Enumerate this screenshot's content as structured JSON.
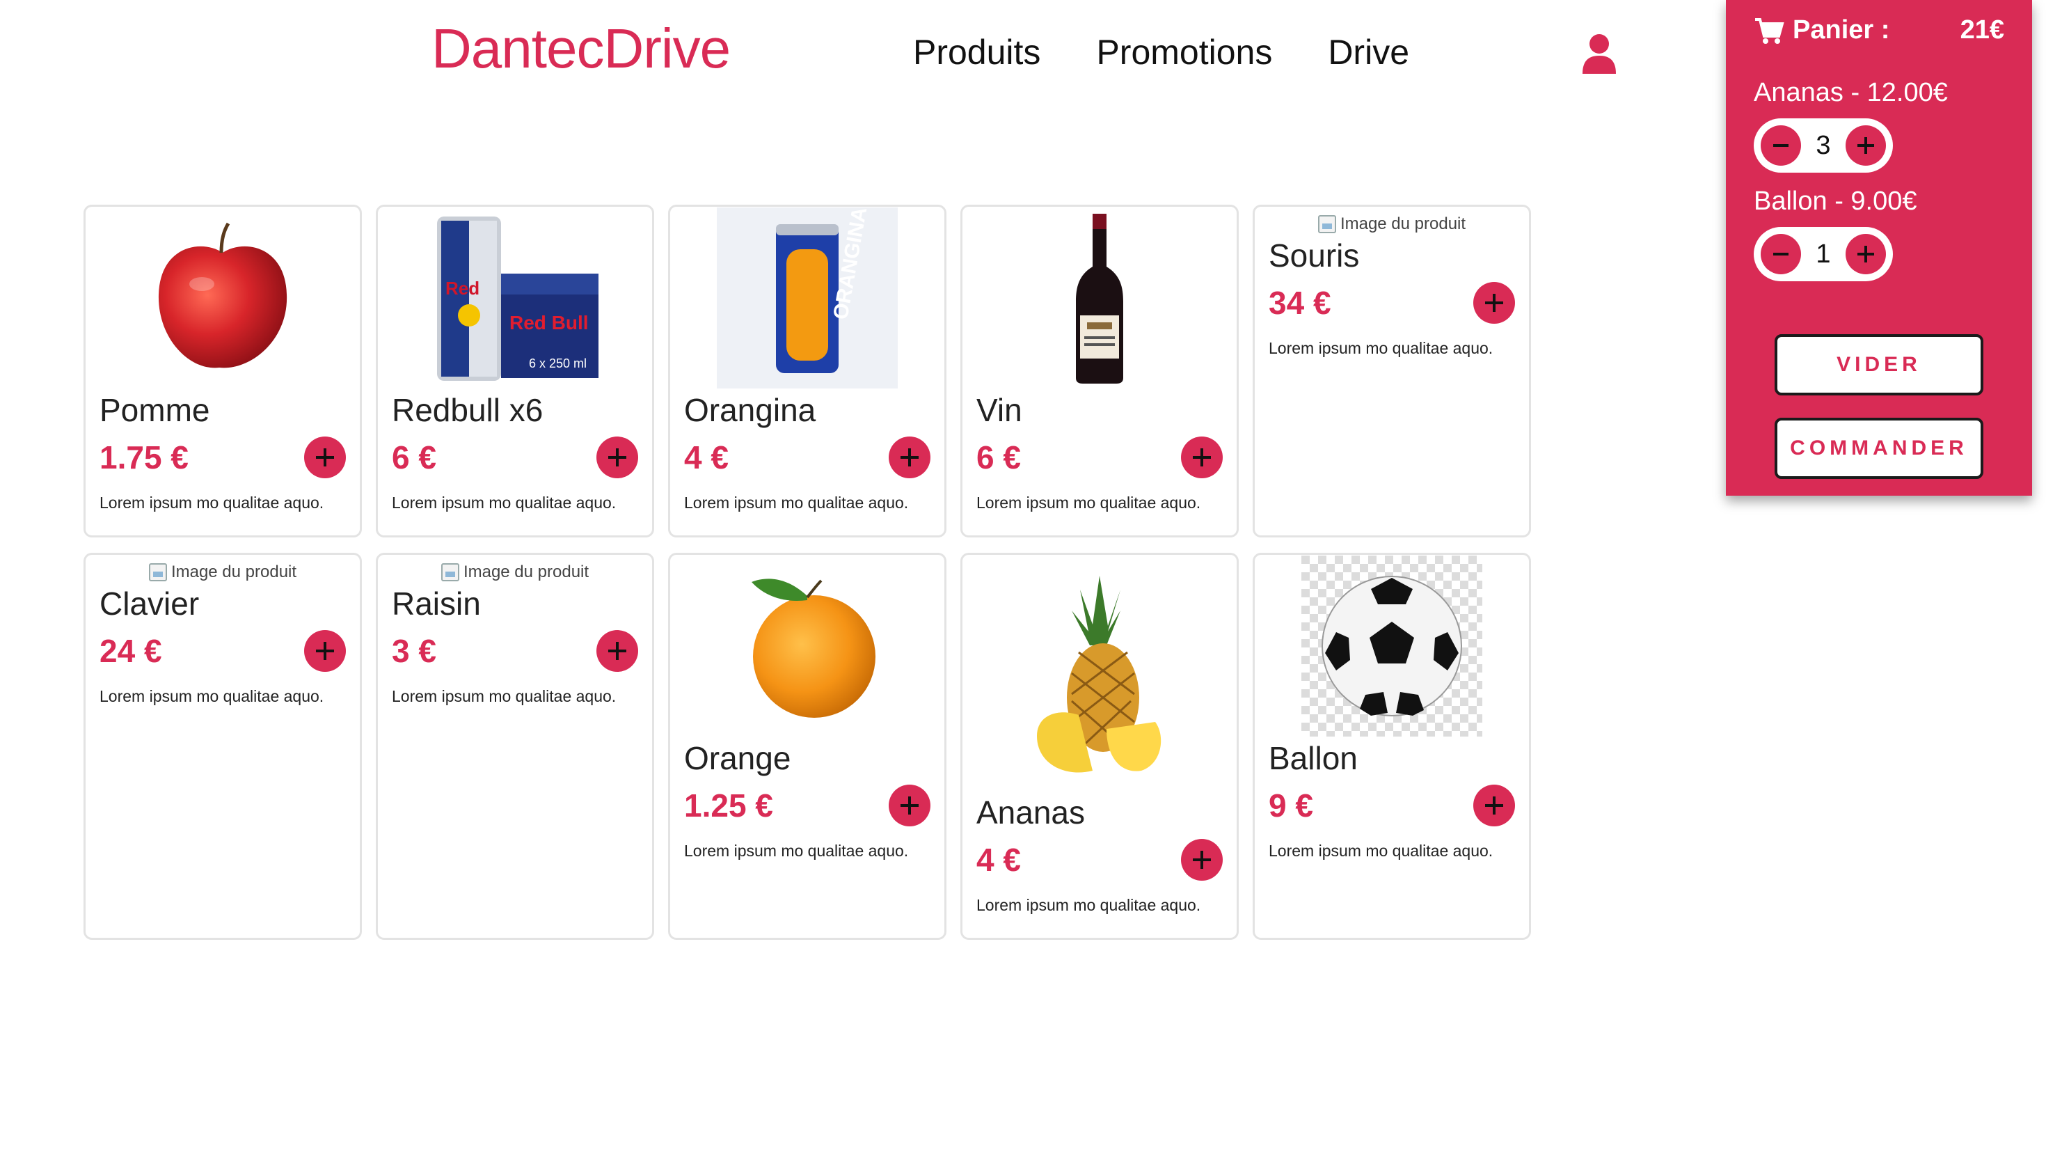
{
  "header": {
    "brand": "DantecDrive",
    "nav": [
      "Produits",
      "Promotions",
      "Drive"
    ]
  },
  "colors": {
    "accent": "#d92b55",
    "border": "#e3e3e3"
  },
  "products": [
    {
      "name": "Pomme",
      "price": "1.75 €",
      "desc": "Lorem ipsum mo qualitae aquo.",
      "image": "apple"
    },
    {
      "name": "Redbull x6",
      "price": "6 €",
      "desc": "Lorem ipsum mo qualitae aquo.",
      "image": "redbull"
    },
    {
      "name": "Orangina",
      "price": "4 €",
      "desc": "Lorem ipsum mo qualitae aquo.",
      "image": "orangina"
    },
    {
      "name": "Vin",
      "price": "6 €",
      "desc": "Lorem ipsum mo qualitae aquo.",
      "image": "wine"
    },
    {
      "name": "Souris",
      "price": "34 €",
      "desc": "Lorem ipsum mo qualitae aquo.",
      "image_alt": "Image du produit"
    },
    {
      "name": "Clavier",
      "price": "24 €",
      "desc": "Lorem ipsum mo qualitae aquo.",
      "image_alt": "Image du produit"
    },
    {
      "name": "Raisin",
      "price": "3 €",
      "desc": "Lorem ipsum mo qualitae aquo.",
      "image_alt": "Image du produit"
    },
    {
      "name": "Orange",
      "price": "1.25 €",
      "desc": "Lorem ipsum mo qualitae aquo.",
      "image": "orange"
    },
    {
      "name": "Ananas",
      "price": "4 €",
      "desc": "Lorem ipsum mo qualitae aquo.",
      "image": "pineapple"
    },
    {
      "name": "Ballon",
      "price": "9 €",
      "desc": "Lorem ipsum mo qualitae aquo.",
      "image": "ball"
    }
  ],
  "cart": {
    "title": "Panier :",
    "total": "21€",
    "items": [
      {
        "label": "Ananas - 12.00€",
        "qty": "3"
      },
      {
        "label": "Ballon - 9.00€",
        "qty": "1"
      }
    ],
    "clear_label": "VIDER",
    "order_label": "COMMANDER"
  }
}
